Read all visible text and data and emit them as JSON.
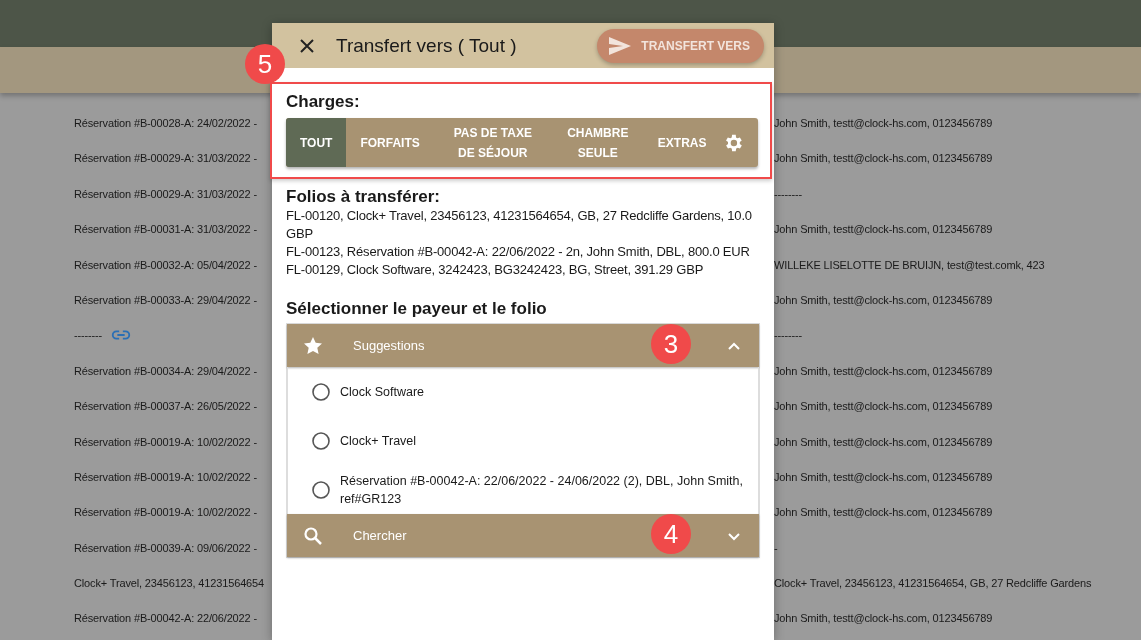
{
  "background": {
    "rows": [
      {
        "left": "Réservation #B-00028-A: 24/02/2022 -",
        "kind": "text",
        "right": "John Smith, testt@clock-hs.com, 0123456789"
      },
      {
        "left": "Réservation #B-00029-A: 31/03/2022 -",
        "kind": "text",
        "right": "John Smith, testt@clock-hs.com, 0123456789"
      },
      {
        "left": "Réservation #B-00029-A: 31/03/2022 -",
        "kind": "text",
        "right": "--------"
      },
      {
        "left": "Réservation #B-00031-A: 31/03/2022 -",
        "kind": "text",
        "right": "John Smith, testt@clock-hs.com, 0123456789"
      },
      {
        "left": "Réservation #B-00032-A: 05/04/2022 -",
        "kind": "text",
        "right": "WILLEKE LISELOTTE DE BRUIJN, test@test.comk, 423"
      },
      {
        "left": "Réservation #B-00033-A: 29/04/2022 -",
        "kind": "text",
        "right": "John Smith, testt@clock-hs.com, 0123456789"
      },
      {
        "left": "--------",
        "kind": "link",
        "right": "--------"
      },
      {
        "left": "Réservation #B-00034-A: 29/04/2022 -",
        "kind": "text",
        "right": "John Smith, testt@clock-hs.com, 0123456789"
      },
      {
        "left": "Réservation #B-00037-A: 26/05/2022 -",
        "kind": "text",
        "right": "John Smith, testt@clock-hs.com, 0123456789"
      },
      {
        "left": "Réservation #B-00019-A: 10/02/2022 -",
        "kind": "text",
        "right": "John Smith, testt@clock-hs.com, 0123456789"
      },
      {
        "left": "Réservation #B-00019-A: 10/02/2022 -",
        "kind": "text",
        "right": "John Smith, testt@clock-hs.com, 0123456789"
      },
      {
        "left": "Réservation #B-00019-A: 10/02/2022 -",
        "kind": "text",
        "right": "John Smith, testt@clock-hs.com, 0123456789"
      },
      {
        "left": "Réservation #B-00039-A: 09/06/2022 -",
        "kind": "text",
        "right": "-"
      },
      {
        "left": "Clock+ Travel, 23456123, 41231564654",
        "kind": "text",
        "right": "Clock+ Travel, 23456123, 41231564654, GB, 27 Redcliffe Gardens"
      },
      {
        "left": "Réservation #B-00042-A: 22/06/2022 -",
        "kind": "text",
        "right": "John Smith, testt@clock-hs.com, 0123456789"
      }
    ]
  },
  "dialog": {
    "title": "Transfert vers ( Tout )",
    "send_button": "TRANSFERT VERS",
    "charges": {
      "label": "Charges:",
      "annotation": "5",
      "tabs": [
        {
          "label": "TOUT",
          "selected": true
        },
        {
          "label": "FORFAITS",
          "selected": false
        },
        {
          "label": "PAS DE TAXE DE SÉJOUR",
          "selected": false
        },
        {
          "label": "CHAMBRE SEULE",
          "selected": false
        },
        {
          "label": "EXTRAS",
          "selected": false
        }
      ]
    },
    "folios": {
      "heading": "Folios à transférer:",
      "lines": [
        "FL-00120, Clock+ Travel, 23456123, 41231564654, GB, 27 Redcliffe Gardens, 10.0 GBP",
        "FL-00123, Réservation #B-00042-A: 22/06/2022 - 2n, John Smith, DBL, 800.0 EUR",
        "FL-00129, Clock Software, 3242423, BG3242423, BG, Street, 391.29 GBP"
      ]
    },
    "payer": {
      "heading": "Sélectionner le payeur et le folio",
      "sections": [
        {
          "kind": "suggestions",
          "label": "Suggestions",
          "annotation": "3",
          "expanded": true,
          "options": [
            {
              "label": "Clock Software",
              "selected": false
            },
            {
              "label": "Clock+ Travel",
              "selected": false
            },
            {
              "label": "Réservation #B-00042-A: 22/06/2022 - 24/06/2022 (2), DBL, John Smith, ref#GR123",
              "selected": false
            }
          ]
        },
        {
          "kind": "search",
          "label": "Chercher",
          "annotation": "4",
          "expanded": false
        }
      ]
    }
  }
}
